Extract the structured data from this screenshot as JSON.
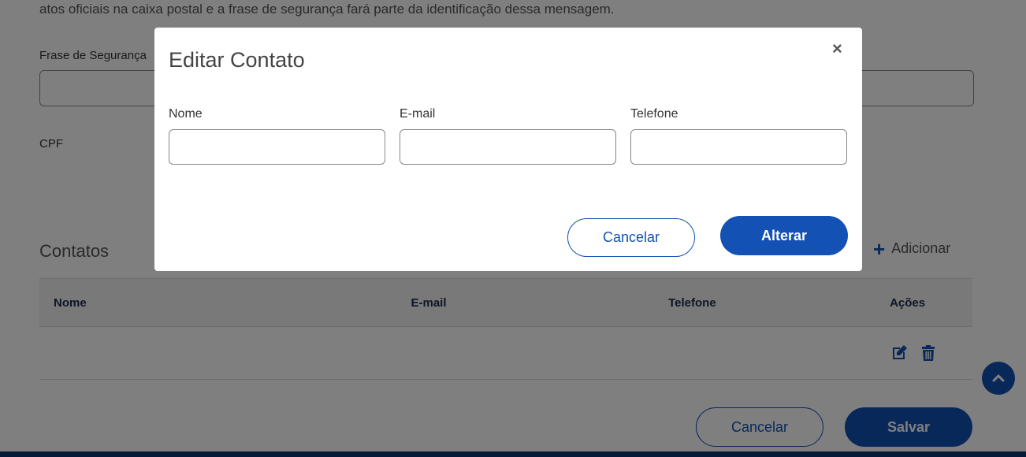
{
  "background": {
    "intro_text": "atos oficiais na caixa postal e a frase de segurança fará parte da identificação dessa mensagem.",
    "security_phrase_label": "Frase de Segurança",
    "cpf_label": "CPF",
    "contacts_title": "Contatos",
    "add_label": "Adicionar",
    "table_headers": [
      "Nome",
      "E-mail",
      "Telefone",
      "Ações"
    ],
    "cancel_label": "Cancelar",
    "save_label": "Salvar"
  },
  "modal": {
    "title": "Editar Contato",
    "close_symbol": "×",
    "fields": [
      {
        "label": "Nome",
        "value": ""
      },
      {
        "label": "E-mail",
        "value": ""
      },
      {
        "label": "Telefone",
        "value": ""
      }
    ],
    "cancel_label": "Cancelar",
    "submit_label": "Alterar"
  },
  "colors": {
    "primary": "#1351b4",
    "dark_navy": "#0c326f",
    "overlay": "rgba(0,0,0,0.5)"
  },
  "icons": [
    "plus-icon",
    "edit-icon",
    "trash-icon",
    "chevron-up-icon"
  ]
}
